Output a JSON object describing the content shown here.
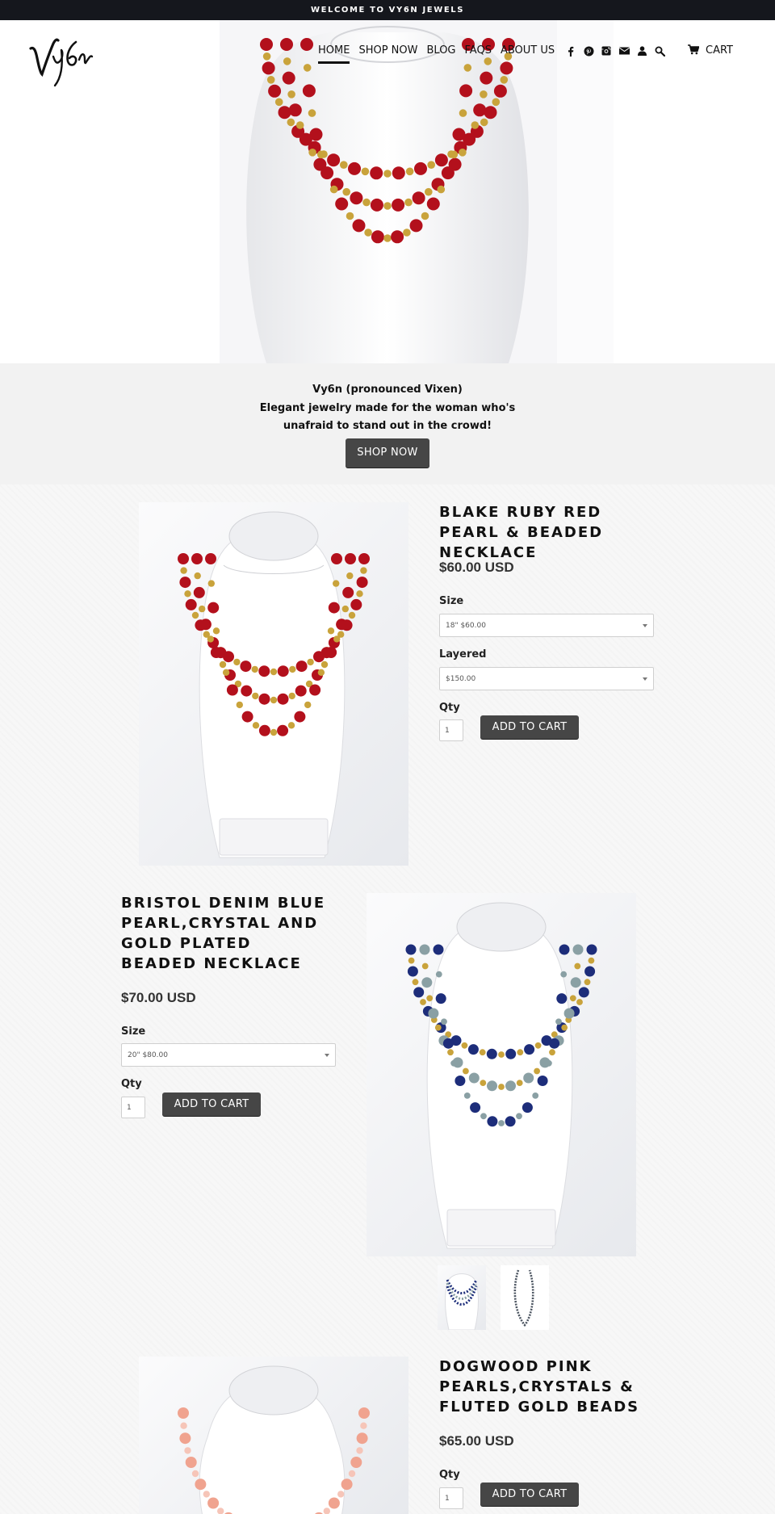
{
  "announcement": "WELCOME TO VY6N JEWELS",
  "brand": {
    "logo_text": "Vy6n"
  },
  "nav": {
    "items": [
      {
        "label": "HOME",
        "active": true
      },
      {
        "label": "SHOP NOW",
        "active": false
      },
      {
        "label": "BLOG",
        "active": false
      },
      {
        "label": "FAQS",
        "active": false
      },
      {
        "label": "ABOUT US",
        "active": false
      }
    ],
    "icons": [
      "facebook-icon",
      "pinterest-icon",
      "instagram-icon",
      "email-icon",
      "account-icon",
      "search-icon"
    ],
    "cart_label": "CART"
  },
  "intro": {
    "line1": "Vy6n (pronounced Vixen)",
    "line2": "Elegant jewelry made for the woman who's",
    "line3": "unafraid to stand out in the crowd!",
    "button": "SHOP NOW"
  },
  "products": [
    {
      "title": "BLAKE RUBY RED PEARL & BEADED NECKLACE",
      "price": "$60.00 USD",
      "options": [
        {
          "label": "Size",
          "value": "18\" $60.00"
        },
        {
          "label": "Layered",
          "value": "$150.00"
        }
      ],
      "qty_label": "Qty",
      "qty": "1",
      "button": "ADD TO CART"
    },
    {
      "title": "BRISTOL DENIM BLUE PEARL,CRYSTAL AND GOLD PLATED BEADED NECKLACE",
      "price": "$70.00 USD",
      "options": [
        {
          "label": "Size",
          "value": "20\" $80.00"
        }
      ],
      "qty_label": "Qty",
      "qty": "1",
      "button": "ADD TO CART"
    },
    {
      "title": "DOGWOOD PINK PEARLS,CRYSTALS & FLUTED GOLD BEADS",
      "price": "$65.00 USD",
      "qty_label": "Qty",
      "qty": "1",
      "button": "ADD TO CART"
    }
  ],
  "colors": {
    "announcement_bg": "#15171d",
    "button_bg": "#464646",
    "ruby": "#b3101c",
    "denim": "#1d2d7a",
    "pearl_gray": "#8aa0a4",
    "gold": "#c9a33b",
    "pink": "#f0a38f"
  }
}
